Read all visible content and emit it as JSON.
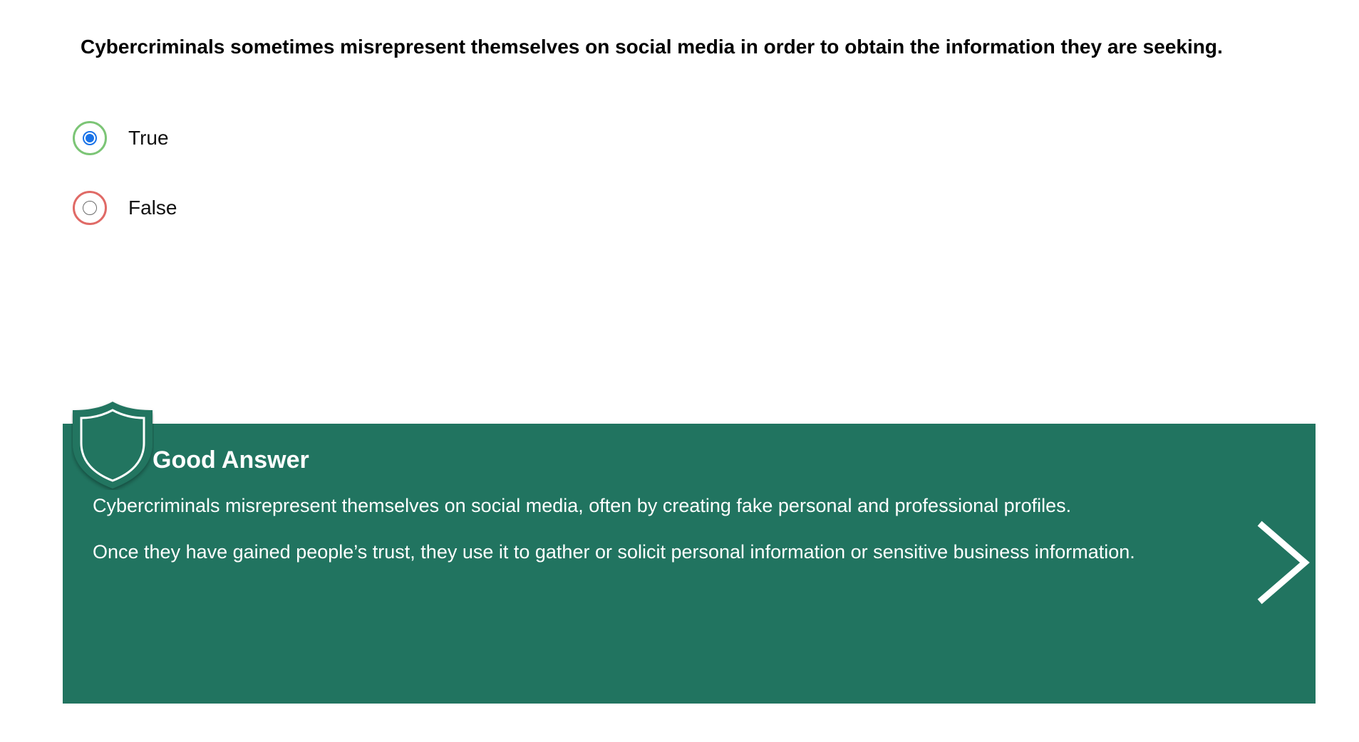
{
  "question": {
    "text": "Cybercriminals sometimes misrepresent themselves on social media in order to obtain the information they are seeking."
  },
  "options": [
    {
      "label": "True",
      "selected": true,
      "ring_color": "#7cc576"
    },
    {
      "label": "False",
      "selected": false,
      "ring_color": "#e06a66"
    }
  ],
  "feedback": {
    "title": "Good Answer",
    "paragraphs": [
      "Cybercriminals misrepresent themselves on social media, often by creating fake personal and professional profiles.",
      "Once they have gained people’s trust, they use it to gather or solicit personal information or sensitive business information."
    ],
    "background_color": "#217460",
    "icon": "shield-icon",
    "next_icon": "chevron-right-icon"
  }
}
